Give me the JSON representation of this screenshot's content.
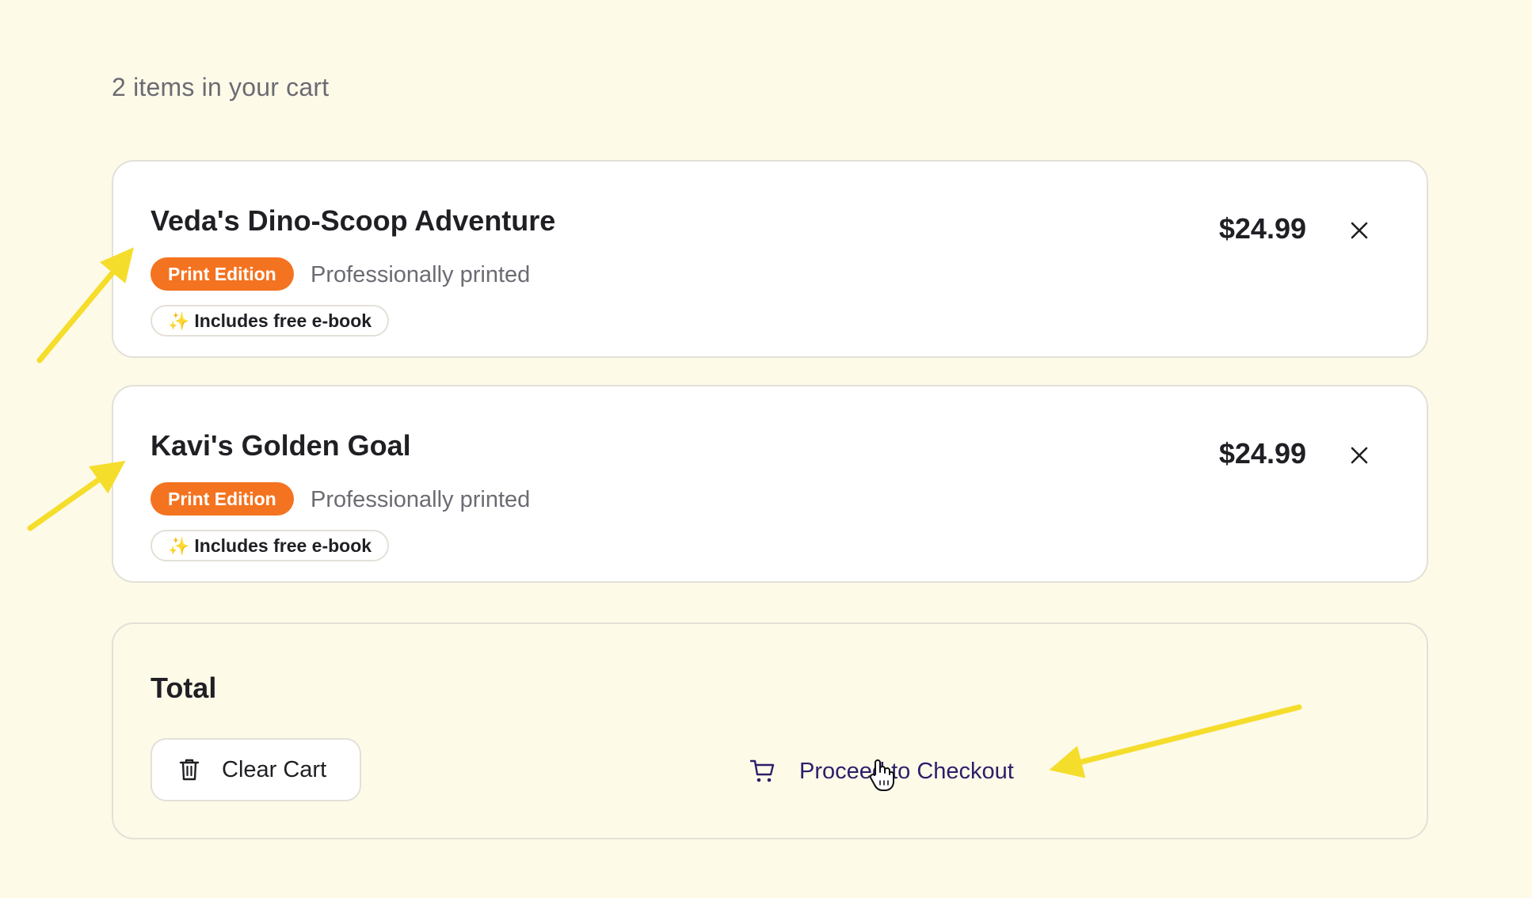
{
  "cart": {
    "summary": "2 items in your cart",
    "items": [
      {
        "title": "Veda's Dino-Scoop Adventure",
        "edition_badge": "Print Edition",
        "edition_desc": "Professionally printed",
        "ebook_note": "Includes free e-book",
        "price": "$24.99"
      },
      {
        "title": "Kavi's Golden Goal",
        "edition_badge": "Print Edition",
        "edition_desc": "Professionally printed",
        "ebook_note": "Includes free e-book",
        "price": "$24.99"
      }
    ],
    "total_label": "Total",
    "clear_cart_label": "Clear Cart",
    "checkout_label": "Proceed to Checkout"
  },
  "icons": {
    "remove": "close-icon",
    "sparkle": "sparkle-icon",
    "trash": "trash-icon",
    "cart": "cart-icon",
    "pointer": "hand-pointer-icon"
  },
  "colors": {
    "background": "#fefae8",
    "badge": "#f47320",
    "checkout_text": "#2b1f6b",
    "annotation_arrow": "#f5dd2b"
  }
}
